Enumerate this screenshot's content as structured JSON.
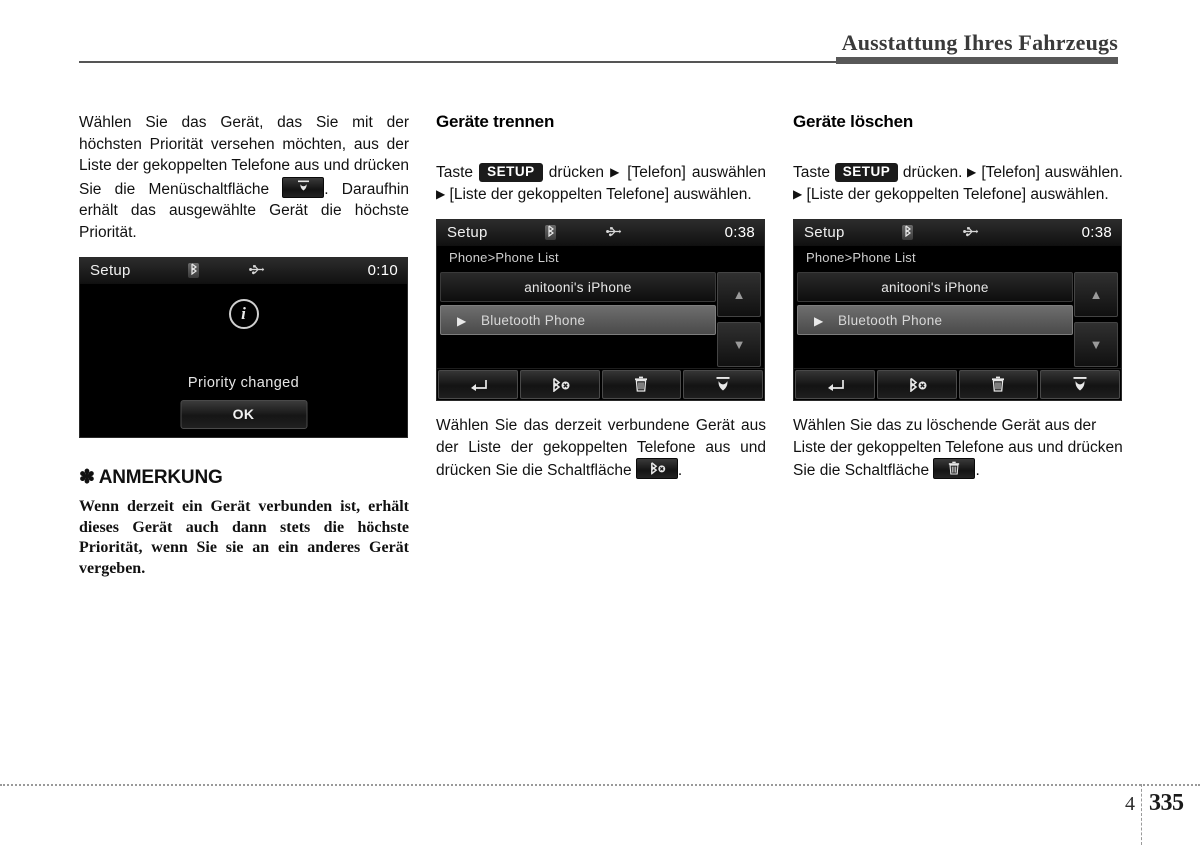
{
  "header": {
    "title": "Ausstattung Ihres Fahrzeugs"
  },
  "footer": {
    "chapter": "4",
    "page": "335"
  },
  "left_column": {
    "paragraph_part1": "Wählen Sie das Gerät, das Sie mit der höchsten Priorität versehen möchten, aus der Liste der gekoppelten Telefone aus und drücken Sie die Menüschaltfläche",
    "paragraph_part2": ". Daraufhin erhält das ausgewählte Gerät die höchste Priorität.",
    "inline_icon": "priority-icon",
    "note": {
      "asterisk": "✽",
      "heading": "ANMERKUNG",
      "body": "Wenn derzeit ein Gerät verbunden ist, erhält dieses Gerät auch dann stets die höchste Priorität, wenn Sie sie an ein anderes Gerät vergeben."
    },
    "screen": {
      "title": "Setup",
      "clock": "0:10",
      "bluetooth_icon": "bluetooth-icon",
      "usb_icon": "usb-icon",
      "info_icon": "info-icon",
      "message": "Priority changed",
      "ok_label": "OK"
    }
  },
  "middle_column": {
    "heading": "Geräte trennen",
    "instruction": {
      "prefix": "Taste",
      "key": "SETUP",
      "text1": "drücken",
      "arrow1": "▶",
      "text2": "[Telefon] auswählen",
      "arrow2": "▶",
      "text3": "[Liste der gekoppelten Telefone] auswählen."
    },
    "screen": {
      "title": "Setup",
      "clock": "0:38",
      "bluetooth_icon": "bluetooth-icon",
      "usb_icon": "usb-icon",
      "breadcrumb": "Phone>Phone List",
      "rows": [
        {
          "label": "anitooni's iPhone",
          "selected": false
        },
        {
          "label": "Bluetooth Phone",
          "selected": true,
          "marker": "▶"
        }
      ],
      "scroll_up": "▲",
      "scroll_down": "▼",
      "toolbar": [
        {
          "name": "back-button",
          "icon": "back-arrow-icon"
        },
        {
          "name": "bluetooth-disconnect-button",
          "icon": "bluetooth-disconnect-icon"
        },
        {
          "name": "delete-button",
          "icon": "trash-icon"
        },
        {
          "name": "priority-button",
          "icon": "priority-icon"
        }
      ]
    },
    "caption_part1": "Wählen Sie das derzeit verbundene Gerät aus der Liste der gekoppelten Telefone aus und drücken Sie die Schaltfläche",
    "caption_part2": ".",
    "caption_icon": "bluetooth-disconnect-icon"
  },
  "right_column": {
    "heading": "Geräte löschen",
    "instruction": {
      "prefix": "Taste",
      "key": "SETUP",
      "text1": "drücken.",
      "arrow1": "▶",
      "text2": "[Telefon] auswählen.",
      "arrow2": "▶",
      "text3": "[Liste der gekoppelten Telefone] auswählen."
    },
    "screen": {
      "title": "Setup",
      "clock": "0:38",
      "bluetooth_icon": "bluetooth-icon",
      "usb_icon": "usb-icon",
      "breadcrumb": "Phone>Phone List",
      "rows": [
        {
          "label": "anitooni's iPhone",
          "selected": false
        },
        {
          "label": "Bluetooth Phone",
          "selected": true,
          "marker": "▶"
        }
      ],
      "scroll_up": "▲",
      "scroll_down": "▼",
      "toolbar": [
        {
          "name": "back-button",
          "icon": "back-arrow-icon"
        },
        {
          "name": "bluetooth-disconnect-button",
          "icon": "bluetooth-disconnect-icon"
        },
        {
          "name": "delete-button",
          "icon": "trash-icon"
        },
        {
          "name": "priority-button",
          "icon": "priority-icon"
        }
      ]
    },
    "caption_part1": "Wählen Sie das zu löschende Gerät aus der Liste der gekoppelten Telefone aus und drücken Sie die Schaltfläche",
    "caption_part2": ".",
    "caption_icon": "trash-icon"
  },
  "colors": {
    "header_rule": "#555555",
    "key_badge_bg": "#1b1b1b",
    "screen_bg": "#000000",
    "selected_row": "#5e5e5e"
  }
}
